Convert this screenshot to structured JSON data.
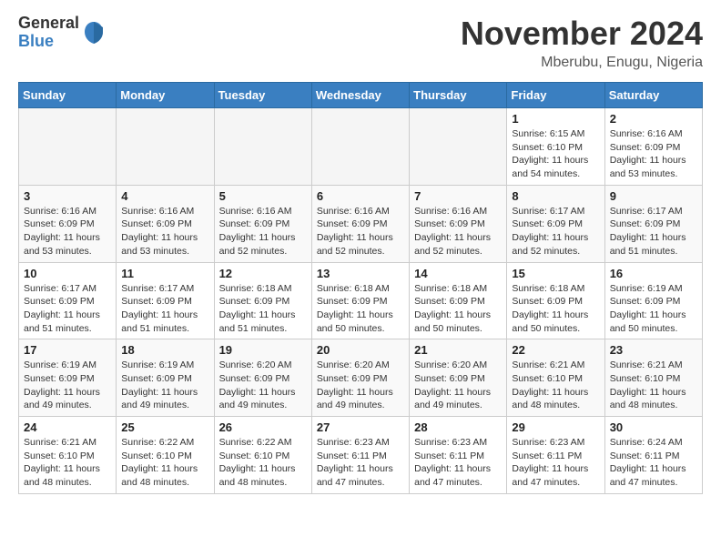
{
  "logo": {
    "general": "General",
    "blue": "Blue"
  },
  "title": "November 2024",
  "location": "Mberubu, Enugu, Nigeria",
  "weekdays": [
    "Sunday",
    "Monday",
    "Tuesday",
    "Wednesday",
    "Thursday",
    "Friday",
    "Saturday"
  ],
  "weeks": [
    [
      {
        "day": "",
        "info": ""
      },
      {
        "day": "",
        "info": ""
      },
      {
        "day": "",
        "info": ""
      },
      {
        "day": "",
        "info": ""
      },
      {
        "day": "",
        "info": ""
      },
      {
        "day": "1",
        "info": "Sunrise: 6:15 AM\nSunset: 6:10 PM\nDaylight: 11 hours and 54 minutes."
      },
      {
        "day": "2",
        "info": "Sunrise: 6:16 AM\nSunset: 6:09 PM\nDaylight: 11 hours and 53 minutes."
      }
    ],
    [
      {
        "day": "3",
        "info": "Sunrise: 6:16 AM\nSunset: 6:09 PM\nDaylight: 11 hours and 53 minutes."
      },
      {
        "day": "4",
        "info": "Sunrise: 6:16 AM\nSunset: 6:09 PM\nDaylight: 11 hours and 53 minutes."
      },
      {
        "day": "5",
        "info": "Sunrise: 6:16 AM\nSunset: 6:09 PM\nDaylight: 11 hours and 52 minutes."
      },
      {
        "day": "6",
        "info": "Sunrise: 6:16 AM\nSunset: 6:09 PM\nDaylight: 11 hours and 52 minutes."
      },
      {
        "day": "7",
        "info": "Sunrise: 6:16 AM\nSunset: 6:09 PM\nDaylight: 11 hours and 52 minutes."
      },
      {
        "day": "8",
        "info": "Sunrise: 6:17 AM\nSunset: 6:09 PM\nDaylight: 11 hours and 52 minutes."
      },
      {
        "day": "9",
        "info": "Sunrise: 6:17 AM\nSunset: 6:09 PM\nDaylight: 11 hours and 51 minutes."
      }
    ],
    [
      {
        "day": "10",
        "info": "Sunrise: 6:17 AM\nSunset: 6:09 PM\nDaylight: 11 hours and 51 minutes."
      },
      {
        "day": "11",
        "info": "Sunrise: 6:17 AM\nSunset: 6:09 PM\nDaylight: 11 hours and 51 minutes."
      },
      {
        "day": "12",
        "info": "Sunrise: 6:18 AM\nSunset: 6:09 PM\nDaylight: 11 hours and 51 minutes."
      },
      {
        "day": "13",
        "info": "Sunrise: 6:18 AM\nSunset: 6:09 PM\nDaylight: 11 hours and 50 minutes."
      },
      {
        "day": "14",
        "info": "Sunrise: 6:18 AM\nSunset: 6:09 PM\nDaylight: 11 hours and 50 minutes."
      },
      {
        "day": "15",
        "info": "Sunrise: 6:18 AM\nSunset: 6:09 PM\nDaylight: 11 hours and 50 minutes."
      },
      {
        "day": "16",
        "info": "Sunrise: 6:19 AM\nSunset: 6:09 PM\nDaylight: 11 hours and 50 minutes."
      }
    ],
    [
      {
        "day": "17",
        "info": "Sunrise: 6:19 AM\nSunset: 6:09 PM\nDaylight: 11 hours and 49 minutes."
      },
      {
        "day": "18",
        "info": "Sunrise: 6:19 AM\nSunset: 6:09 PM\nDaylight: 11 hours and 49 minutes."
      },
      {
        "day": "19",
        "info": "Sunrise: 6:20 AM\nSunset: 6:09 PM\nDaylight: 11 hours and 49 minutes."
      },
      {
        "day": "20",
        "info": "Sunrise: 6:20 AM\nSunset: 6:09 PM\nDaylight: 11 hours and 49 minutes."
      },
      {
        "day": "21",
        "info": "Sunrise: 6:20 AM\nSunset: 6:09 PM\nDaylight: 11 hours and 49 minutes."
      },
      {
        "day": "22",
        "info": "Sunrise: 6:21 AM\nSunset: 6:10 PM\nDaylight: 11 hours and 48 minutes."
      },
      {
        "day": "23",
        "info": "Sunrise: 6:21 AM\nSunset: 6:10 PM\nDaylight: 11 hours and 48 minutes."
      }
    ],
    [
      {
        "day": "24",
        "info": "Sunrise: 6:21 AM\nSunset: 6:10 PM\nDaylight: 11 hours and 48 minutes."
      },
      {
        "day": "25",
        "info": "Sunrise: 6:22 AM\nSunset: 6:10 PM\nDaylight: 11 hours and 48 minutes."
      },
      {
        "day": "26",
        "info": "Sunrise: 6:22 AM\nSunset: 6:10 PM\nDaylight: 11 hours and 48 minutes."
      },
      {
        "day": "27",
        "info": "Sunrise: 6:23 AM\nSunset: 6:11 PM\nDaylight: 11 hours and 47 minutes."
      },
      {
        "day": "28",
        "info": "Sunrise: 6:23 AM\nSunset: 6:11 PM\nDaylight: 11 hours and 47 minutes."
      },
      {
        "day": "29",
        "info": "Sunrise: 6:23 AM\nSunset: 6:11 PM\nDaylight: 11 hours and 47 minutes."
      },
      {
        "day": "30",
        "info": "Sunrise: 6:24 AM\nSunset: 6:11 PM\nDaylight: 11 hours and 47 minutes."
      }
    ]
  ]
}
